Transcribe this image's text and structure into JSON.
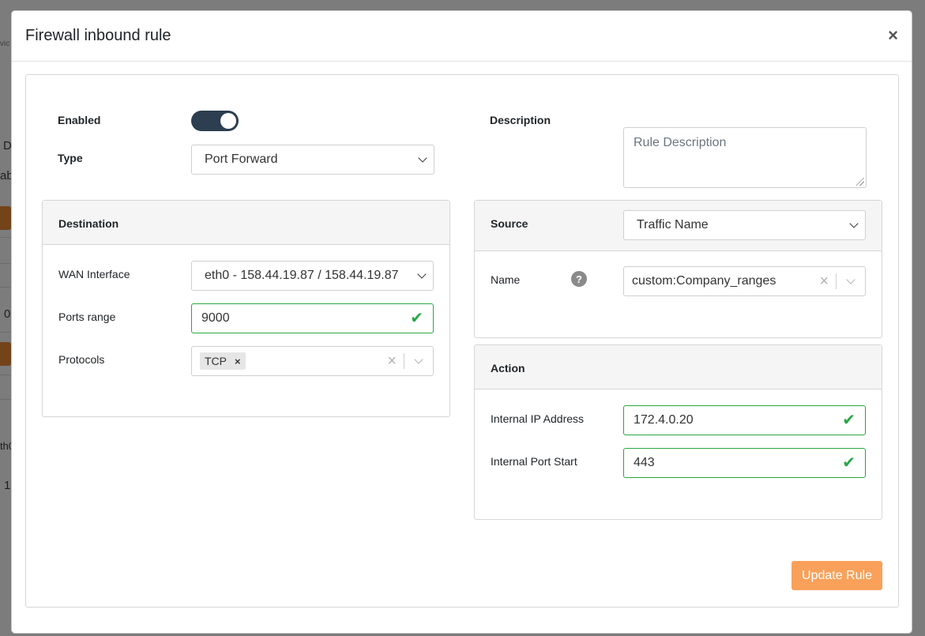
{
  "background": {
    "fragments": [
      "vic",
      "D",
      "abl",
      "+",
      "0",
      "th0",
      "1"
    ]
  },
  "modal": {
    "title": "Firewall inbound rule",
    "close_label": "×"
  },
  "general": {
    "enabled_label": "Enabled",
    "enabled": true,
    "type_label": "Type",
    "type_value": "Port Forward",
    "description_label": "Description",
    "description_placeholder": "Rule Description"
  },
  "destination": {
    "title": "Destination",
    "wan_label": "WAN Interface",
    "wan_value": "eth0 - 158.44.19.87 / 158.44.19.87",
    "ports_label": "Ports range",
    "ports_value": "9000",
    "protocols_label": "Protocols",
    "protocols": [
      "TCP"
    ]
  },
  "source": {
    "title": "Source",
    "mode_value": "Traffic Name",
    "name_label": "Name",
    "help_icon": "?",
    "name_value": "custom:Company_ranges"
  },
  "action": {
    "title": "Action",
    "ip_label": "Internal IP Address",
    "ip_value": "172.4.0.20",
    "port_label": "Internal Port Start",
    "port_value": "443"
  },
  "footer": {
    "submit_label": "Update Rule"
  },
  "colors": {
    "accent": "#f9a15a",
    "valid": "#28a745",
    "toggle_on": "#2c3e50"
  }
}
